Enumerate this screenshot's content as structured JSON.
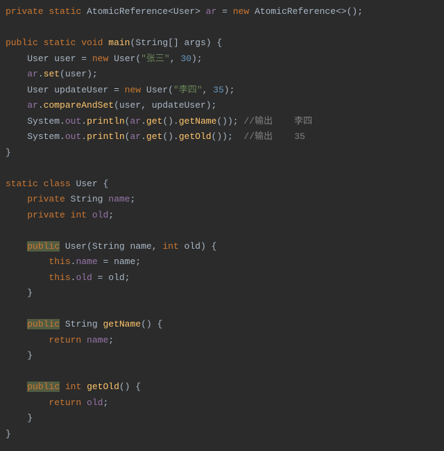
{
  "code": {
    "l1": {
      "kw1": "private",
      "kw2": "static",
      "type1": "AtomicReference",
      "lt": "<",
      "type2": "User",
      "gt": ">",
      "field": "ar",
      "eq": " = ",
      "kw3": "new",
      "ctor": "AtomicReference",
      "diamond": "<>",
      "paren": "()",
      "semi": ";"
    },
    "l3": {
      "kw1": "public",
      "kw2": "static",
      "kw3": "void",
      "method": "main",
      "lparen": "(",
      "argtype": "String",
      "brackets": "[]",
      "argname": "args",
      "rparen": ")",
      "brace": " {"
    },
    "l4": {
      "type": "User",
      "var": "user",
      "eq": " = ",
      "kw": "new",
      "ctor": "User",
      "lparen": "(",
      "str": "\"张三\"",
      "comma": ", ",
      "num": "30",
      "rparen": ")",
      "semi": ";"
    },
    "l5": {
      "field": "ar",
      "dot": ".",
      "method": "set",
      "lparen": "(",
      "arg": "user",
      "rparen": ")",
      "semi": ";"
    },
    "l6": {
      "type": "User",
      "var": "updateUser",
      "eq": " = ",
      "kw": "new",
      "ctor": "User",
      "lparen": "(",
      "str": "\"李四\"",
      "comma": ", ",
      "num": "35",
      "rparen": ")",
      "semi": ";"
    },
    "l7": {
      "field": "ar",
      "dot1": ".",
      "method": "compareAndSet",
      "lparen": "(",
      "arg1": "user",
      "comma": ", ",
      "arg2": "updateUser",
      "rparen": ")",
      "semi": ";"
    },
    "l8": {
      "cls": "System",
      "dot1": ".",
      "out": "out",
      "dot2": ".",
      "println": "println",
      "lparen": "(",
      "ar": "ar",
      "dot3": ".",
      "get": "get",
      "p1": "()",
      "dot4": ".",
      "getname": "getName",
      "p2": "()",
      "rparen": ")",
      "semi": ";",
      "cmt": " //输出    李四"
    },
    "l9": {
      "cls": "System",
      "dot1": ".",
      "out": "out",
      "dot2": ".",
      "println": "println",
      "lparen": "(",
      "ar": "ar",
      "dot3": ".",
      "get": "get",
      "p1": "()",
      "dot4": ".",
      "getold": "getOld",
      "p2": "()",
      "rparen": ")",
      "semi": ";",
      "cmt": "  //输出    35"
    },
    "l10": {
      "brace": "}"
    },
    "l12": {
      "kw1": "static",
      "kw2": "class",
      "cls": "User",
      "brace": " {"
    },
    "l13": {
      "kw": "private",
      "type": "String",
      "field": "name",
      "semi": ";"
    },
    "l14": {
      "kw": "private",
      "kw2": "int",
      "field": "old",
      "semi": ";"
    },
    "l16": {
      "kw": "public",
      "ctor": "User",
      "lparen": "(",
      "ptype1": "String",
      "pname1": "name",
      "comma": ", ",
      "ptype2": "int",
      "pname2": "old",
      "rparen": ")",
      "brace": " {"
    },
    "l17": {
      "this": "this",
      "dot": ".",
      "field": "name",
      "eq": " = ",
      "arg": "name",
      "semi": ";"
    },
    "l18": {
      "this": "this",
      "dot": ".",
      "field": "old",
      "eq": " = ",
      "arg": "old",
      "semi": ";"
    },
    "l19": {
      "brace": "}"
    },
    "l21": {
      "kw": "public",
      "type": "String",
      "method": "getName",
      "paren": "()",
      "brace": " {"
    },
    "l22": {
      "kw": "return",
      "field": "name",
      "semi": ";"
    },
    "l23": {
      "brace": "}"
    },
    "l25": {
      "kw": "public",
      "kw2": "int",
      "method": "getOld",
      "paren": "()",
      "brace": " {"
    },
    "l26": {
      "kw": "return",
      "field": "old",
      "semi": ";"
    },
    "l27": {
      "brace": "}"
    },
    "l28": {
      "brace": "}"
    }
  }
}
